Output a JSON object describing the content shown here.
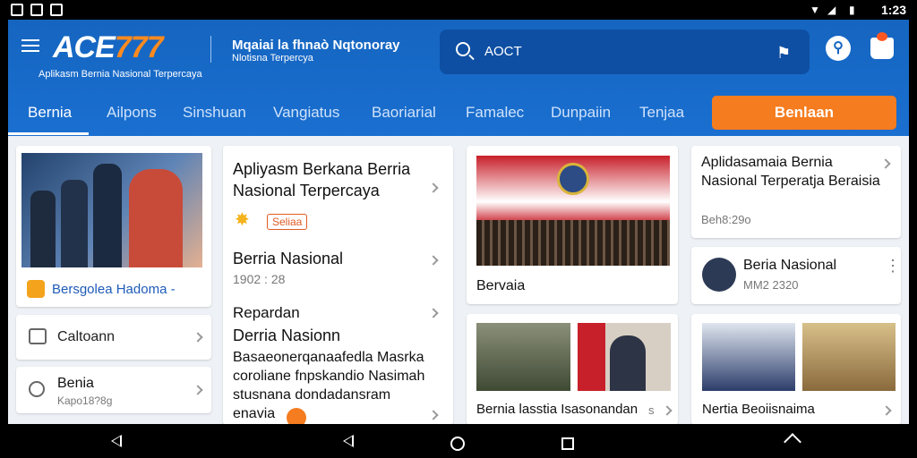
{
  "status": {
    "time": "1:23"
  },
  "header": {
    "logo_ace": "ACE",
    "logo_num": "777",
    "logo_tagline": "Aplikasm Bernia Nasional Terpercaya",
    "title": "Mqaiai la fhnaò Nqtonoray",
    "subtitle": "Nlotisna Terpercya",
    "search_text": "AOCT",
    "search_icon": "search-icon",
    "user_icon": "user-icon",
    "bag_icon": "shopping-bag-icon"
  },
  "tabs": [
    {
      "label": "Bernia"
    },
    {
      "label": "Ailpons"
    },
    {
      "label": "Sinshuan"
    },
    {
      "label": "Vangiatus"
    },
    {
      "label": "Baoriarial"
    },
    {
      "label": "Famalec"
    },
    {
      "label": "Dunpaiin"
    },
    {
      "label": "Tenjaa"
    }
  ],
  "cta_label": "Benlaan",
  "cards": {
    "hero_caption": "Bersgolea Hadoma  -",
    "cat1": "Caltoann",
    "cat2_title": "Benia",
    "cat2_sub": "Kapo18?8g",
    "article1_title": "Apliyasm Berkana Berria Nasional Terpercaya",
    "badge": "Seliaa",
    "article2_title": "Berria Nasional",
    "article2_date": "1902 : 28",
    "article3_label": "Repardan",
    "article3_title": "Derria Nasionn",
    "article3_body": "Basaeonerqanaafedla Masrka coroliane fnpskandio Nasimah stusnana dondadansram enavia",
    "photo1_caption": "Bervaia",
    "photo2_caption": "Bernia lasstia Isasonandan",
    "photo2_more": "s",
    "right1_title": "Aplidasamaia Bernia Nasional Terperatja Beraisia",
    "right1_date": "Beh8:29o",
    "right2_title": "Beria Nasional",
    "right2_date": "MM2 2320",
    "right3_caption": "Nertia Beoiisnaima"
  }
}
